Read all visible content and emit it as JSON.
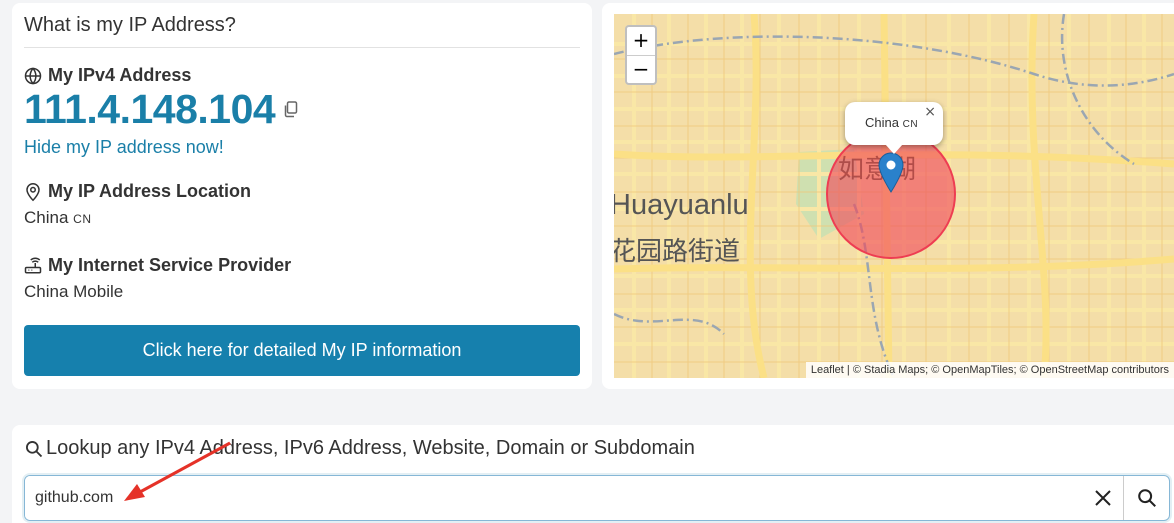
{
  "ip_card": {
    "title": "What is my IP Address?",
    "ipv4_heading": "My IPv4 Address",
    "ip_value": "111.4.148.104",
    "hide_link": "Hide my IP address now!",
    "location_heading": "My IP Address Location",
    "location_value": "China",
    "location_code": "CN",
    "isp_heading": "My Internet Service Provider",
    "isp_value": "China Mobile",
    "detail_button": "Click here for detailed My IP information"
  },
  "map": {
    "zoom_in": "+",
    "zoom_out": "−",
    "popup_text": "China",
    "popup_code": "CN",
    "popup_close": "×",
    "place_label_en": "Huayuanlu",
    "place_label_zh": "花园路街道",
    "place_label_zh2": "如意湖",
    "attribution": {
      "leaflet": "Leaflet",
      "rest": " | © Stadia Maps; © OpenMapTiles; © OpenStreetMap contributors"
    }
  },
  "lookup": {
    "heading": "Lookup any IPv4 Address, IPv6 Address, Website, Domain or Subdomain",
    "input_value": "github.com"
  },
  "colors": {
    "accent": "#1a7fa8",
    "button": "#1680ad",
    "map_base": "#f4dea8",
    "map_road": "#fbe49c",
    "circle": "#f0485a",
    "marker": "#2a81cb",
    "annotation_arrow": "#e53228"
  },
  "icons": [
    "globe-icon",
    "copy-icon",
    "location-pin-icon",
    "router-icon",
    "search-icon",
    "clear-icon",
    "map-marker-icon",
    "annotation-arrow"
  ]
}
